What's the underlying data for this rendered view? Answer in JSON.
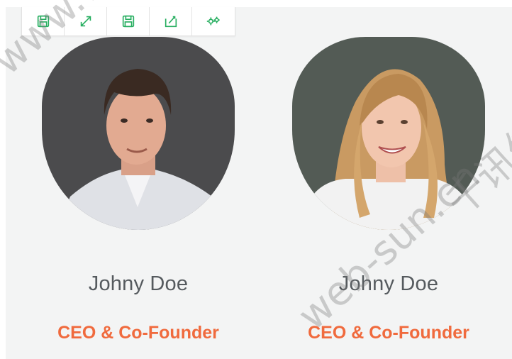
{
  "toolbar": {
    "buttons": [
      {
        "icon": "save-icon"
      },
      {
        "icon": "move-icon"
      },
      {
        "icon": "save-icon"
      },
      {
        "icon": "edit-icon"
      },
      {
        "icon": "settings-icon"
      }
    ],
    "accent": "#27ae60"
  },
  "team": [
    {
      "name": "Johny Doe",
      "role": "CEO & Co-Founder"
    },
    {
      "name": "Johny Doe",
      "role": "CEO & Co-Founder"
    }
  ],
  "watermark": {
    "text1": "www.web-sun.cn",
    "text2": "web-sun.cn",
    "text3": "千讯信"
  },
  "colors": {
    "role": "#f06a3d",
    "name": "#555a5e",
    "background": "#f3f4f4"
  }
}
